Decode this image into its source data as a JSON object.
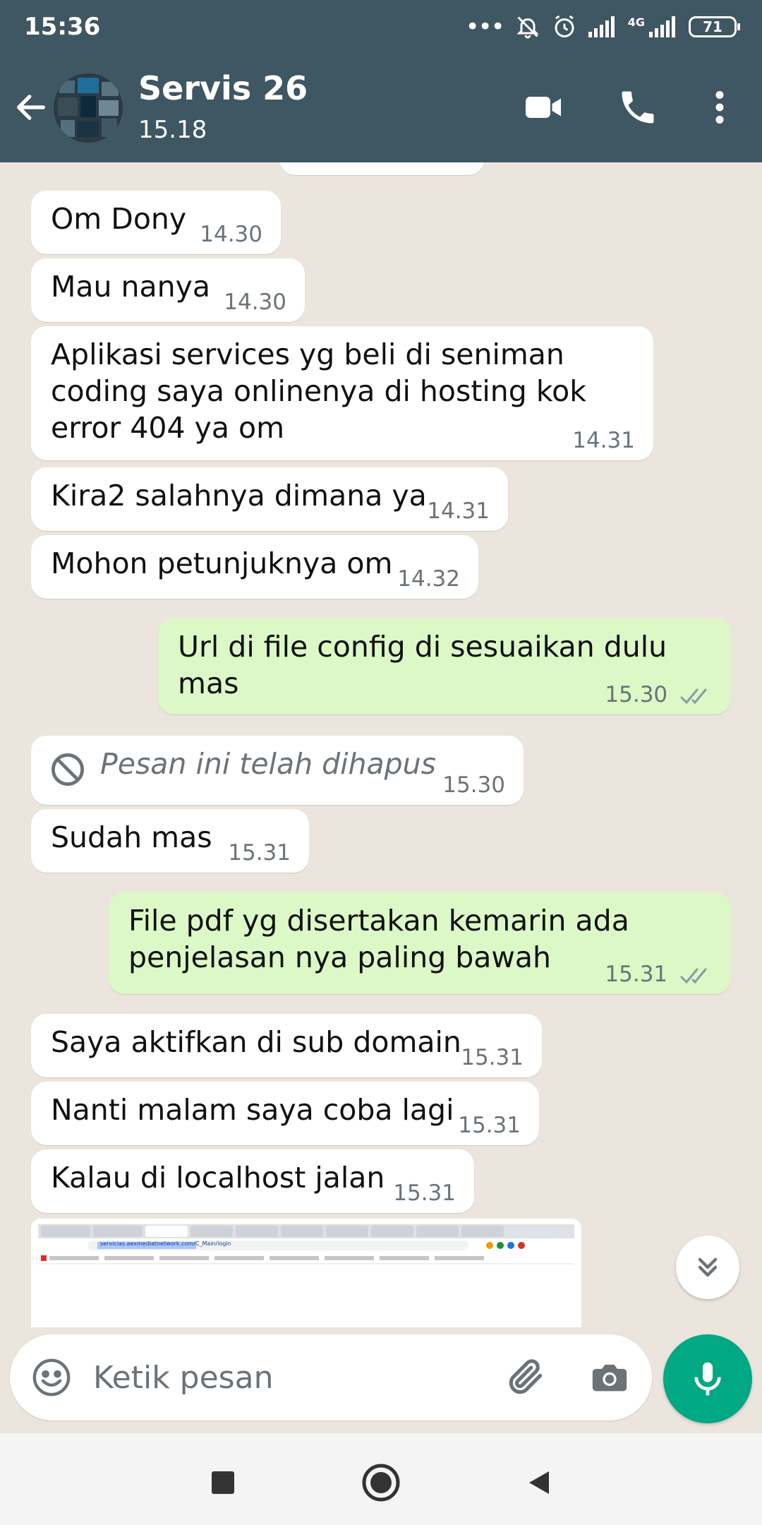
{
  "status_bar": {
    "time": "15:36",
    "network": "4G",
    "battery": "71"
  },
  "header": {
    "contact_name": "Servis 26",
    "contact_status": "15.18"
  },
  "messages": [
    {
      "direction": "in",
      "text": "Om Dony",
      "time": "14.30"
    },
    {
      "direction": "in",
      "text": "Mau nanya",
      "time": "14.30"
    },
    {
      "direction": "in",
      "text": "Aplikasi services yg beli di seniman coding saya onlinenya di hosting kok error 404 ya om",
      "time": "14.31"
    },
    {
      "direction": "in",
      "text": "Kira2 salahnya dimana ya",
      "time": "14.31"
    },
    {
      "direction": "in",
      "text": "Mohon petunjuknya om",
      "time": "14.32"
    },
    {
      "direction": "out",
      "text": "Url di file config di sesuaikan dulu mas",
      "time": "15.30",
      "status": "read"
    },
    {
      "direction": "in",
      "text": "Pesan ini telah dihapus",
      "time": "15.30",
      "deleted": true
    },
    {
      "direction": "in",
      "text": "Sudah mas",
      "time": "15.31"
    },
    {
      "direction": "out",
      "text": "File pdf yg disertakan kemarin ada penjelasan nya paling bawah",
      "time": "15.31",
      "status": "read"
    },
    {
      "direction": "in",
      "text": "Saya aktifkan di sub domain",
      "time": "15.31"
    },
    {
      "direction": "in",
      "text": "Nanti malam saya coba lagi",
      "time": "15.31"
    },
    {
      "direction": "in",
      "text": "Kalau di localhost jalan",
      "time": "15.31"
    }
  ],
  "image_message": {
    "url_text": "servicias.aexmediatnetwork.com/C_Main/login"
  },
  "composer": {
    "placeholder": "Ketik pesan"
  },
  "icons": {
    "back": "arrow-left-icon",
    "video": "video-call-icon",
    "call": "phone-icon",
    "menu": "more-vertical-icon",
    "emoji": "emoji-icon",
    "attach": "paperclip-icon",
    "camera": "camera-icon",
    "mic": "mic-icon",
    "scroll": "chevron-double-down-icon"
  },
  "colors": {
    "header": "#3f5663",
    "chat_bg": "#ece5dd",
    "outgoing": "#dcf8c6",
    "incoming": "#ffffff",
    "accent": "#00a884",
    "read_ticks": "#8a9aa3"
  }
}
